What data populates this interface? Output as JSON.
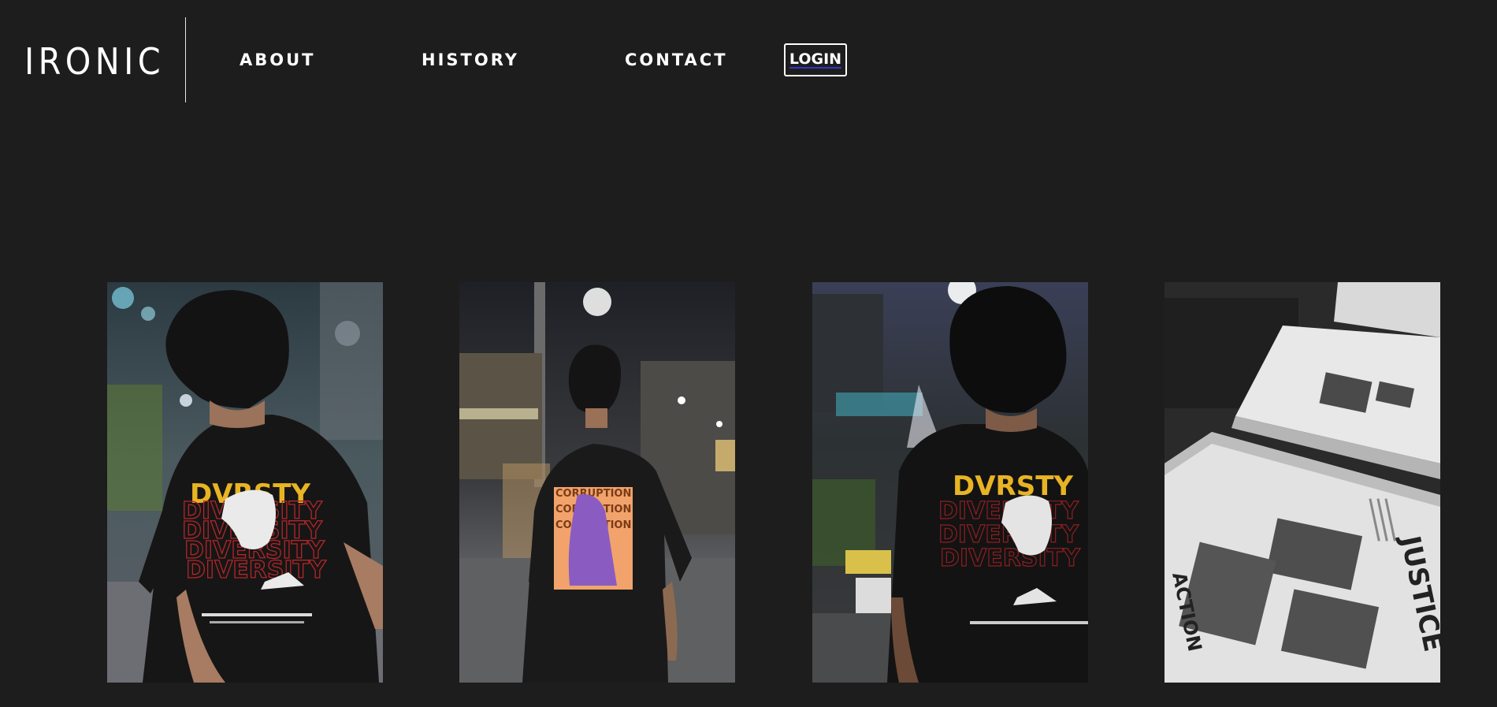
{
  "header": {
    "logo_text": "IRONIC",
    "nav": [
      {
        "label": "ABOUT"
      },
      {
        "label": "HISTORY"
      },
      {
        "label": "CONTACT"
      }
    ],
    "login_label": "LOGIN"
  },
  "gallery": {
    "photos": [
      {
        "shirt_title": "DVRSTY",
        "shirt_repeat": "DIVERSITY"
      },
      {
        "shirt_title": "CORRUPTION",
        "shirt_repeat": "CORRUPTION"
      },
      {
        "shirt_title": "DVRSTY",
        "shirt_repeat": "DIVERSITY"
      },
      {
        "print_title": "JUSTICE",
        "print_sub": "ACTION"
      }
    ]
  },
  "colors": {
    "background": "#1d1d1d",
    "text": "#ffffff",
    "shirt_yellow": "#e8b423",
    "shirt_red": "#b3262a",
    "shirt_orange": "#f2a36b",
    "shirt_purple": "#8a5cc2",
    "login_underline": "#3333cc"
  }
}
